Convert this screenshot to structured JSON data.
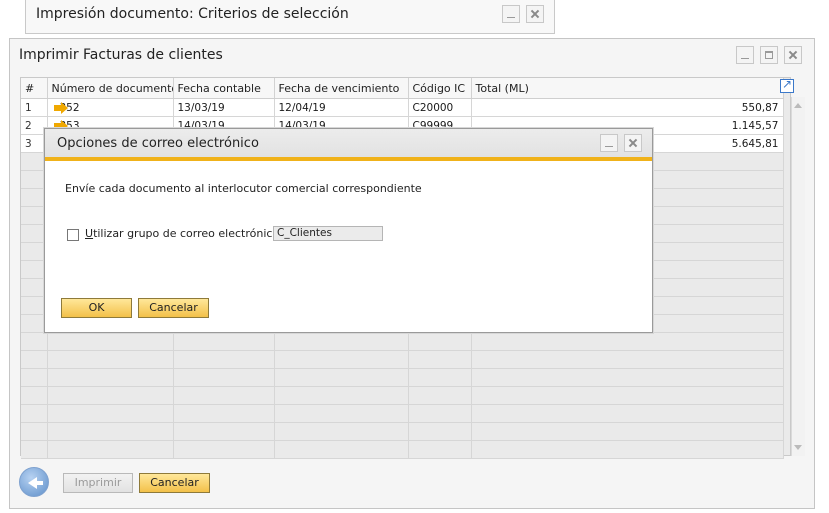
{
  "background_window": {
    "title": "Impresión documento: Criterios de selección"
  },
  "main_window": {
    "title": "Imprimir Facturas de clientes",
    "grid": {
      "columns": [
        "#",
        "Número de documento",
        "Fecha contable",
        "Fecha de vencimiento",
        "Código IC",
        "Total (ML)"
      ],
      "rows": [
        {
          "num": "1",
          "doc": "352",
          "fecha_contable": "13/03/19",
          "fecha_venc": "12/04/19",
          "codigo": "C20000",
          "total": "550,87"
        },
        {
          "num": "2",
          "doc": "353",
          "fecha_contable": "14/03/19",
          "fecha_venc": "14/03/19",
          "codigo": "C99999",
          "total": "1.145,57"
        },
        {
          "num": "3",
          "doc": "",
          "fecha_contable": "",
          "fecha_venc": "",
          "codigo": "",
          "total": "5.645,81"
        }
      ]
    },
    "buttons": {
      "print": "Imprimir",
      "cancel": "Cancelar"
    }
  },
  "dialog": {
    "title": "Opciones de correo electrónico",
    "message": "Envíe cada documento al interlocutor comercial correspondiente",
    "checkbox_label_accel": "U",
    "checkbox_label_rest": "tilizar grupo de correo electrónico",
    "checkbox_checked": false,
    "group_value": "C_Clientes",
    "ok_label": "OK",
    "cancel_label": "Cancelar"
  },
  "colors": {
    "accent": "#f0b21a",
    "button_fill": "#f3c14a",
    "arrow": "#f0a800",
    "link_blue": "#3b78c9"
  }
}
